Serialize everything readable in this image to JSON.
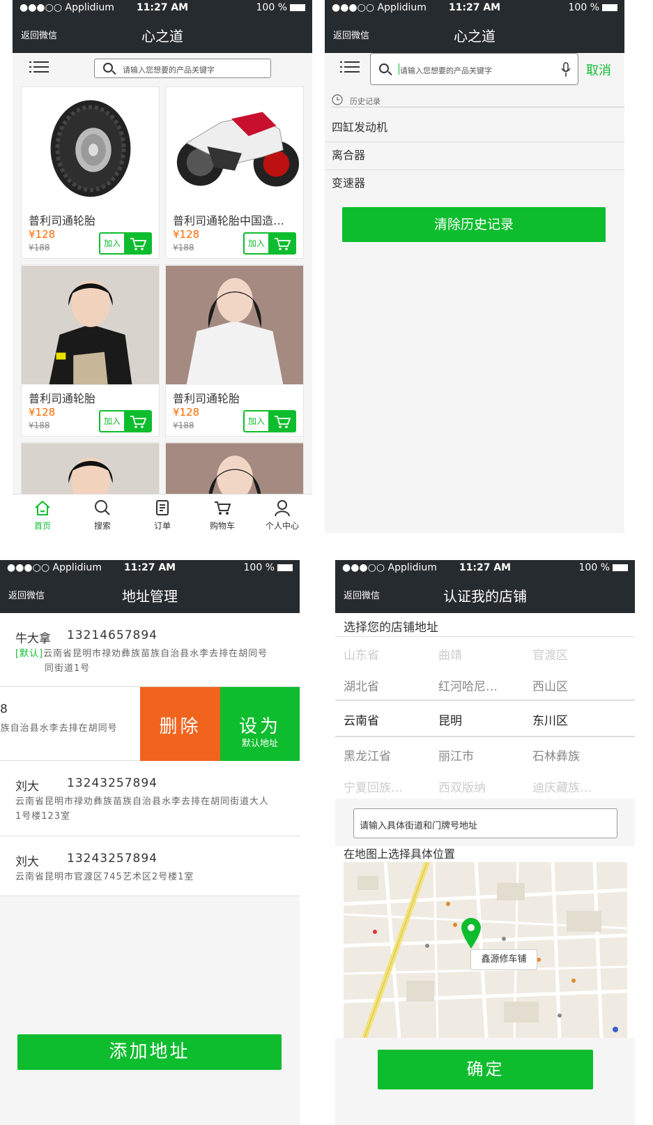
{
  "status": {
    "carrier": "●●●○○ Applidium",
    "time": "11:27 AM",
    "battery": "100 %"
  },
  "screen1": {
    "back": "返回微信",
    "title": "心之道",
    "search_placeholder": "请输入您想要的产品关键字",
    "products": [
      {
        "name": "普利司通轮胎",
        "price": "¥128",
        "old_price": "¥188",
        "add_label": "加入",
        "image": "tire"
      },
      {
        "name": "普利司通轮胎中国造…",
        "price": "¥128",
        "old_price": "¥188",
        "add_label": "加入",
        "image": "motorcycle"
      },
      {
        "name": "普利司通轮胎",
        "price": "¥128",
        "old_price": "¥188",
        "add_label": "加入",
        "image": "girl-black-shirt"
      },
      {
        "name": "普利司通轮胎",
        "price": "¥128",
        "old_price": "¥188",
        "add_label": "加入",
        "image": "girl-white-shirt"
      }
    ],
    "tabs": [
      {
        "label": "首页",
        "icon": "home-icon",
        "active": true
      },
      {
        "label": "搜索",
        "icon": "search-icon",
        "active": false
      },
      {
        "label": "订单",
        "icon": "order-icon",
        "active": false
      },
      {
        "label": "购物车",
        "icon": "cart-icon",
        "active": false
      },
      {
        "label": "个人中心",
        "icon": "user-icon",
        "active": false
      }
    ]
  },
  "screen2": {
    "back": "返回微信",
    "title": "心之道",
    "search_placeholder": "请输入您想要的产品关键字",
    "cancel": "取消",
    "history_title": "历史记录",
    "history": [
      "四缸发动机",
      "离合器",
      "变速器"
    ],
    "clear_button": "清除历史记录"
  },
  "screen3": {
    "back": "返回微信",
    "title": "地址管理",
    "addresses": [
      {
        "name": "牛大拿",
        "phone": "13214657894",
        "default_tag": "[默认]",
        "address_line1": "云南省昆明市禄劝彝族苗族自治县水李去排在胡同号",
        "address_line2": "同街道1号"
      },
      {
        "phone_tail": "8",
        "address_partial": "i族自治县水李去排在胡同号",
        "delete_label": "删除",
        "set_label": "设为",
        "set_sub": "默认地址"
      },
      {
        "name": "刘大",
        "phone": "13243257894",
        "address_line1": "云南省昆明市禄劝彝族苗族自治县水李去排在胡同街道大人",
        "address_line2": "1号楼123室"
      },
      {
        "name": "刘大",
        "phone": "13243257894",
        "address_line1": "云南省昆明市官渡区745艺术区2号楼1室"
      }
    ],
    "add_button": "添加地址"
  },
  "screen4": {
    "back": "返回微信",
    "title": "认证我的店铺",
    "section_title": "选择您的店铺地址",
    "picker_rows": [
      [
        "山东省",
        "曲靖",
        "官渡区"
      ],
      [
        "湖北省",
        "红河哈尼…",
        "西山区"
      ],
      [
        "云南省",
        "昆明",
        "东川区"
      ],
      [
        "黑龙江省",
        "丽江市",
        "石林彝族"
      ],
      [
        "宁夏回族…",
        "西双版纳",
        "迪庆藏族…"
      ]
    ],
    "street_placeholder": "请输入具体街道和门牌号地址",
    "map_title": "在地图上选择具体位置",
    "map_marker_label": "鑫源修车铺",
    "confirm_button": "确定"
  },
  "colors": {
    "accent": "#0ebd2e",
    "price": "#ff6a00",
    "delete": "#f0641e",
    "nav": "#262b2f"
  }
}
